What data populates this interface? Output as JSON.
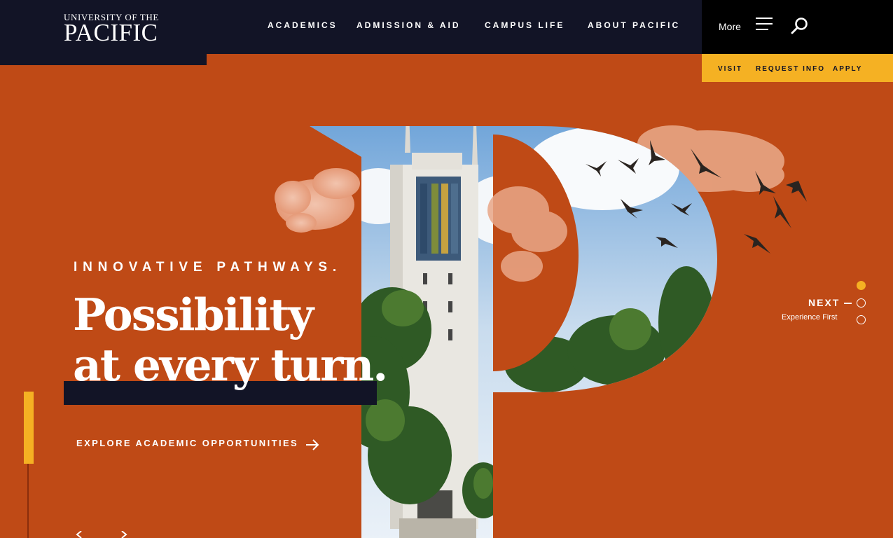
{
  "logo": {
    "line1": "UNIVERSITY OF THE",
    "line2": "PACIFIC"
  },
  "nav": [
    {
      "label": "ACADEMICS"
    },
    {
      "label": "ADMISSION & AID"
    },
    {
      "label": "CAMPUS LIFE"
    },
    {
      "label": "ABOUT PACIFIC"
    }
  ],
  "utility": {
    "more_label": "More"
  },
  "cta": [
    {
      "label": "VISIT"
    },
    {
      "label": "REQUEST INFO"
    },
    {
      "label": "APPLY"
    }
  ],
  "hero": {
    "eyebrow": "INNOVATIVE PATHWAYS.",
    "headline_line1": "Possibility",
    "headline_line2": "at every turn.",
    "cta_label": "EXPLORE ACADEMIC OPPORTUNITIES"
  },
  "slider": {
    "next_label": "NEXT",
    "next_subtitle": "Experience First",
    "slide_count": 3,
    "active_index": 0
  },
  "colors": {
    "brand_orange": "#BF4A16",
    "navy": "#121426",
    "gold": "#F5B123"
  },
  "icons": [
    "hamburger-icon",
    "search-icon",
    "arrow-right-icon",
    "chevron-left-icon",
    "chevron-right-icon"
  ]
}
